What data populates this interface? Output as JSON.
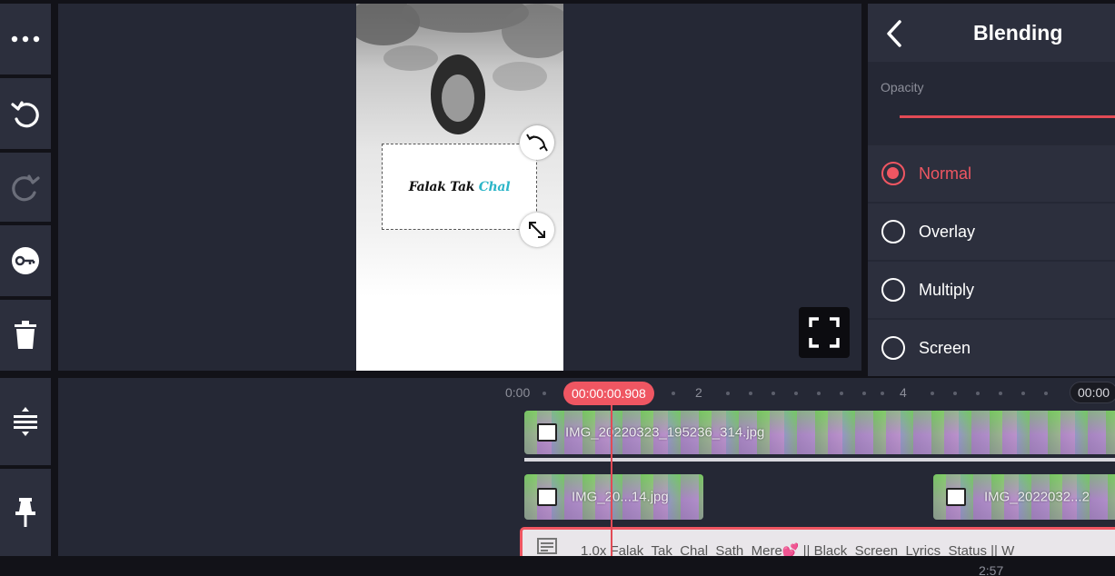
{
  "toolbar": {
    "buttons": [
      "more",
      "undo",
      "redo",
      "keyframe",
      "delete"
    ],
    "timeline_buttons": [
      "split-layer",
      "pin"
    ]
  },
  "preview": {
    "sticker_text_part1": "Falak Tak",
    "sticker_text_part2": "Chal"
  },
  "blending": {
    "title": "Blending",
    "opacity_label": "Opacity",
    "opacity_value": 1.0,
    "options": [
      {
        "label": "Normal",
        "selected": true
      },
      {
        "label": "Overlay",
        "selected": false
      },
      {
        "label": "Multiply",
        "selected": false
      },
      {
        "label": "Screen",
        "selected": false
      }
    ]
  },
  "timeline": {
    "ruler": [
      "0:00",
      "2",
      "4"
    ],
    "current_time": "00:00:00.908",
    "end_time": "00:00",
    "clips": {
      "main": "IMG_20220323_195236_314.jpg",
      "layer_a": "IMG_20...14.jpg",
      "layer_b": "IMG_2022032...2"
    },
    "audio": "1.0x Falak_Tak_Chal_Sath_Mere💕 || Black_Screen_Lyrics_Status || W"
  },
  "bottom": {
    "time": "2:57"
  },
  "colors": {
    "accent": "#ef5662",
    "panel": "#2c2f3d",
    "background": "#252835"
  }
}
